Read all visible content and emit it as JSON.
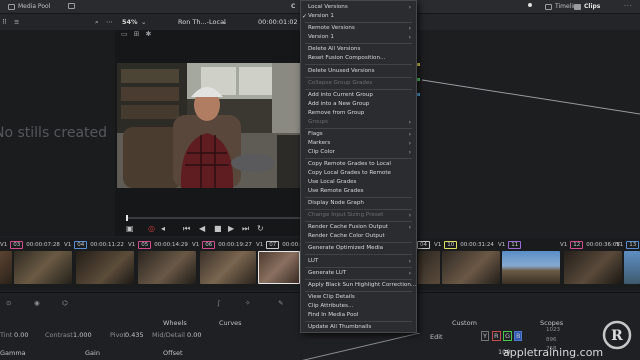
{
  "topbar": {
    "media_pool": "Media Pool",
    "clip_title": "C",
    "timeline": "Timeline",
    "clips": "Clips"
  },
  "toolbar2": {
    "zoom": "54%",
    "clip_name": "Ron Th...-Local",
    "timecode": "00:00:01:02"
  },
  "gallery": {
    "no_stills": "No stills created"
  },
  "context_menu": {
    "items": [
      {
        "label": "Local Versions",
        "disabled": false,
        "submenu": true,
        "checked": false
      },
      {
        "label": "Version 1",
        "disabled": false,
        "submenu": false,
        "checked": true
      },
      {
        "label": "Remote Versions",
        "disabled": false,
        "submenu": true,
        "checked": false
      },
      {
        "label": "Version 1",
        "disabled": false,
        "submenu": true,
        "checked": false
      },
      {
        "label": "Delete All Versions",
        "disabled": false,
        "submenu": false,
        "checked": false
      },
      {
        "label": "Reset Fusion Composition...",
        "disabled": false,
        "submenu": false,
        "checked": false
      },
      {
        "label": "Delete Unused Versions",
        "disabled": false,
        "submenu": false,
        "checked": false
      },
      {
        "label": "Collapse Group Grades",
        "disabled": true,
        "submenu": false,
        "checked": false
      },
      {
        "label": "Add into Current Group",
        "disabled": false,
        "submenu": false,
        "checked": false
      },
      {
        "label": "Add into a New Group",
        "disabled": false,
        "submenu": false,
        "checked": false
      },
      {
        "label": "Remove from Group",
        "disabled": false,
        "submenu": false,
        "checked": false
      },
      {
        "label": "Groups",
        "disabled": true,
        "submenu": true,
        "checked": false
      },
      {
        "label": "Flags",
        "disabled": false,
        "submenu": true,
        "checked": false
      },
      {
        "label": "Markers",
        "disabled": false,
        "submenu": true,
        "checked": false
      },
      {
        "label": "Clip Color",
        "disabled": false,
        "submenu": true,
        "checked": false
      },
      {
        "label": "Copy Remote Grades to Local",
        "disabled": false,
        "submenu": false,
        "checked": false
      },
      {
        "label": "Copy Local Grades to Remote",
        "disabled": false,
        "submenu": false,
        "checked": false
      },
      {
        "label": "Use Local Grades",
        "disabled": false,
        "submenu": false,
        "checked": false
      },
      {
        "label": "Use Remote Grades",
        "disabled": false,
        "submenu": false,
        "checked": false
      },
      {
        "label": "Display Node Graph",
        "disabled": false,
        "submenu": false,
        "checked": false
      },
      {
        "label": "Change Input Sizing Preset",
        "disabled": true,
        "submenu": true,
        "checked": false
      },
      {
        "label": "Render Cache Fusion Output",
        "disabled": false,
        "submenu": true,
        "checked": false
      },
      {
        "label": "Render Cache Color Output",
        "disabled": false,
        "submenu": false,
        "checked": false
      },
      {
        "label": "Generate Optimized Media",
        "disabled": false,
        "submenu": false,
        "checked": false
      },
      {
        "label": "LUT",
        "disabled": false,
        "submenu": true,
        "checked": false
      },
      {
        "label": "Generate LUT",
        "disabled": false,
        "submenu": true,
        "checked": false
      },
      {
        "label": "Apply Black Sun Highlight Correction...",
        "disabled": false,
        "submenu": false,
        "checked": false
      },
      {
        "label": "View Clip Details",
        "disabled": false,
        "submenu": false,
        "checked": false
      },
      {
        "label": "Clip Attributes...",
        "disabled": false,
        "submenu": false,
        "checked": false
      },
      {
        "label": "Find In Media Pool",
        "disabled": false,
        "submenu": false,
        "checked": false
      },
      {
        "label": "Update All Thumbnails",
        "disabled": false,
        "submenu": false,
        "checked": false
      }
    ]
  },
  "clips": [
    {
      "num": "03",
      "track": "V1",
      "tc": "00:00:07:28",
      "color": "#d24b8f"
    },
    {
      "num": "04",
      "track": "V1",
      "tc": "00:00:11:22",
      "color": "#5a8fd6"
    },
    {
      "num": "05",
      "track": "V1",
      "tc": "00:00:14:29",
      "color": "#d24b8f"
    },
    {
      "num": "06",
      "track": "V1",
      "tc": "00:00:19:27",
      "color": "#d24b8f"
    },
    {
      "num": "07",
      "track": "V1",
      "tc": "00:00:2",
      "color": "#c9c9c9"
    },
    {
      "num": "04",
      "track": "",
      "tc": "",
      "color": "#c9c9c9"
    },
    {
      "num": "10",
      "track": "V1",
      "tc": "00:00:31:24",
      "color": "#e0e060"
    },
    {
      "num": "11",
      "track": "V1",
      "tc": "",
      "color": "#9a6ad6"
    },
    {
      "num": "12",
      "track": "V1",
      "tc": "00:00:36:05",
      "color": "#d24b8f"
    },
    {
      "num": "13",
      "track": "V1",
      "tc": "",
      "color": "#5a8fd6"
    }
  ],
  "bottom": {
    "wheels": "Wheels",
    "curves": "Curves",
    "custom": "Custom",
    "scopes": "Scopes",
    "tint_label": "Tint",
    "tint_value": "0.00",
    "contrast_label": "Contrast",
    "contrast_value": "1.000",
    "pivot_label": "Pivot",
    "pivot_value": "0.435",
    "middetail_label": "Mid/Detail",
    "middetail_value": "0.00",
    "gamma": "Gamma",
    "gain": "Gain",
    "offset": "Offset",
    "edit": "Edit",
    "channels": [
      "Y",
      "R",
      "G",
      "B"
    ],
    "curve_value": "100",
    "scope_1023": "1023",
    "scope_896": "896",
    "scope_768": "768"
  },
  "watermark": {
    "text": "appletraining.com",
    "logo_letter": "R"
  }
}
